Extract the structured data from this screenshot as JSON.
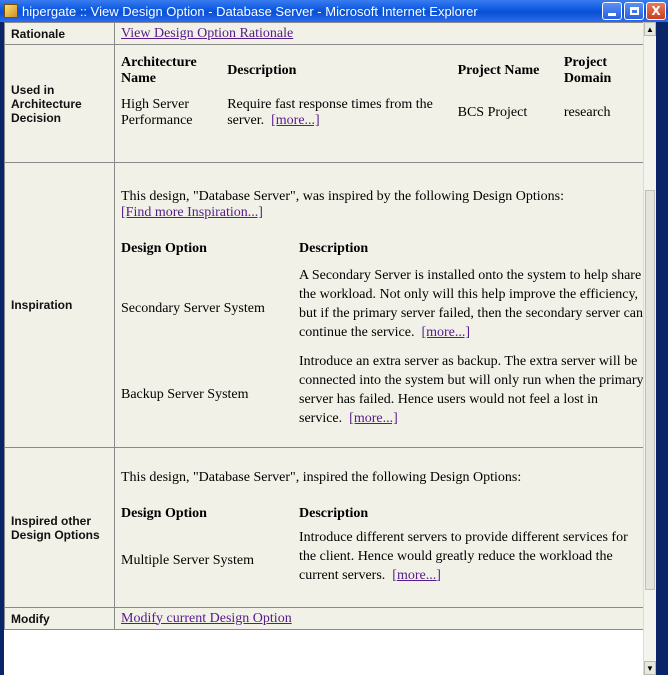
{
  "window": {
    "title": "hipergate :: View Design Option - Database Server - Microsoft Internet Explorer",
    "buttons": {
      "minimize": "_",
      "maximize": "□",
      "close": "X"
    }
  },
  "rows": {
    "rationale": {
      "label": "Rationale",
      "link": "View Design Option Rationale"
    },
    "used_in": {
      "label": "Used in Architecture Decision",
      "headers": [
        "Architecture Name",
        "Description",
        "Project Name",
        "Project Domain"
      ],
      "rows": [
        {
          "name": "High Server Performance",
          "description": "Require fast response times from the server.",
          "more": "[more...]",
          "project": "BCS Project",
          "domain": "research"
        }
      ]
    },
    "inspiration": {
      "label": "Inspiration",
      "intro": "This design, \"Database Server\", was inspired by the following Design Options:",
      "find_more": "[Find more Inspiration...]",
      "headers": [
        "Design Option",
        "Description"
      ],
      "items": [
        {
          "option": "Secondary Server System",
          "description": "A Secondary Server is installed onto the system to help share the workload. Not only will this help improve the efficiency, but if the primary server failed, then the secondary server can continue the service.",
          "more": "[more...]"
        },
        {
          "option": "Backup Server System",
          "description": "Introduce an extra server as backup. The extra server will be connected into the system but will only run when the primary server has failed. Hence users would not feel a lost in service.",
          "more": "[more...]"
        }
      ]
    },
    "inspired_other": {
      "label": "Inspired other Design Options",
      "intro": "This design, \"Database Server\", inspired the following Design Options:",
      "headers": [
        "Design Option",
        "Description"
      ],
      "items": [
        {
          "option": "Multiple Server System",
          "description": "Introduce different servers to provide different services for the client. Hence would greatly reduce the workload the current servers.",
          "more": "[more...]"
        }
      ]
    },
    "modify": {
      "label": "Modify",
      "link": "Modify current Design Option"
    }
  }
}
